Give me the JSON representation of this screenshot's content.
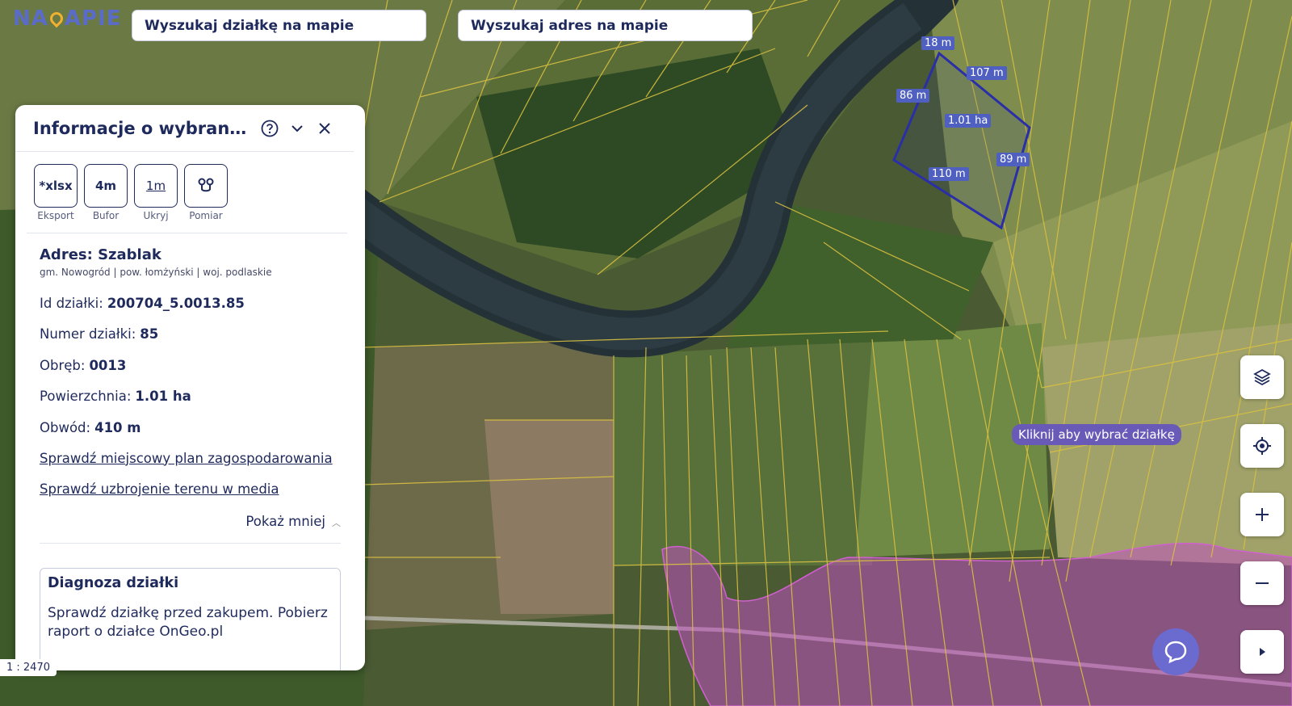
{
  "search": {
    "parcel_placeholder": "Wyszukaj działkę na mapie",
    "address_placeholder": "Wyszukaj adres na mapie"
  },
  "panel": {
    "title": "Informacje o wybranej dzi...",
    "tools": [
      {
        "icon_text": "*xlsx",
        "label": "Eksport"
      },
      {
        "icon_text": "4m",
        "label": "Bufor"
      },
      {
        "icon_text": "1m",
        "label": "Ukryj"
      },
      {
        "icon": "measure-pins-icon",
        "label": "Pomiar"
      }
    ],
    "address_title": "Adres: Szablak",
    "address_sub": "gm. Nowogród | pow. łomżyński | woj. podlaskie",
    "rows": [
      {
        "label": "Id działki:",
        "value": "200704_5.0013.85"
      },
      {
        "label": "Numer działki:",
        "value": "85"
      },
      {
        "label": "Obręb:",
        "value": "0013"
      },
      {
        "label": "Powierzchnia:",
        "value": "1.01 ha"
      },
      {
        "label": "Obwód:",
        "value": "410 m"
      }
    ],
    "links": [
      "Sprawdź miejscowy plan zagospodarowania",
      "Sprawdź uzbrojenie terenu w media"
    ],
    "show_less": "Pokaż mniej",
    "diagnosis": {
      "title": "Diagnoza działki",
      "text": "Sprawdź działkę przed zakupem. Pobierz raport o działce OnGeo.pl"
    }
  },
  "map": {
    "scale": "1 : 2470",
    "tooltip": "Kliknij aby wybrać działkę",
    "measure_labels": [
      "18 m",
      "107 m",
      "86 m",
      "1.01 ha",
      "89 m",
      "110 m"
    ]
  },
  "colors": {
    "accent": "#1f2a5c",
    "parcel_outline": "#2a2fa8",
    "parcel_lines": "#d9c040",
    "zone_fill": "#c050c0",
    "tooltip_bg": "#6a5ab8"
  }
}
